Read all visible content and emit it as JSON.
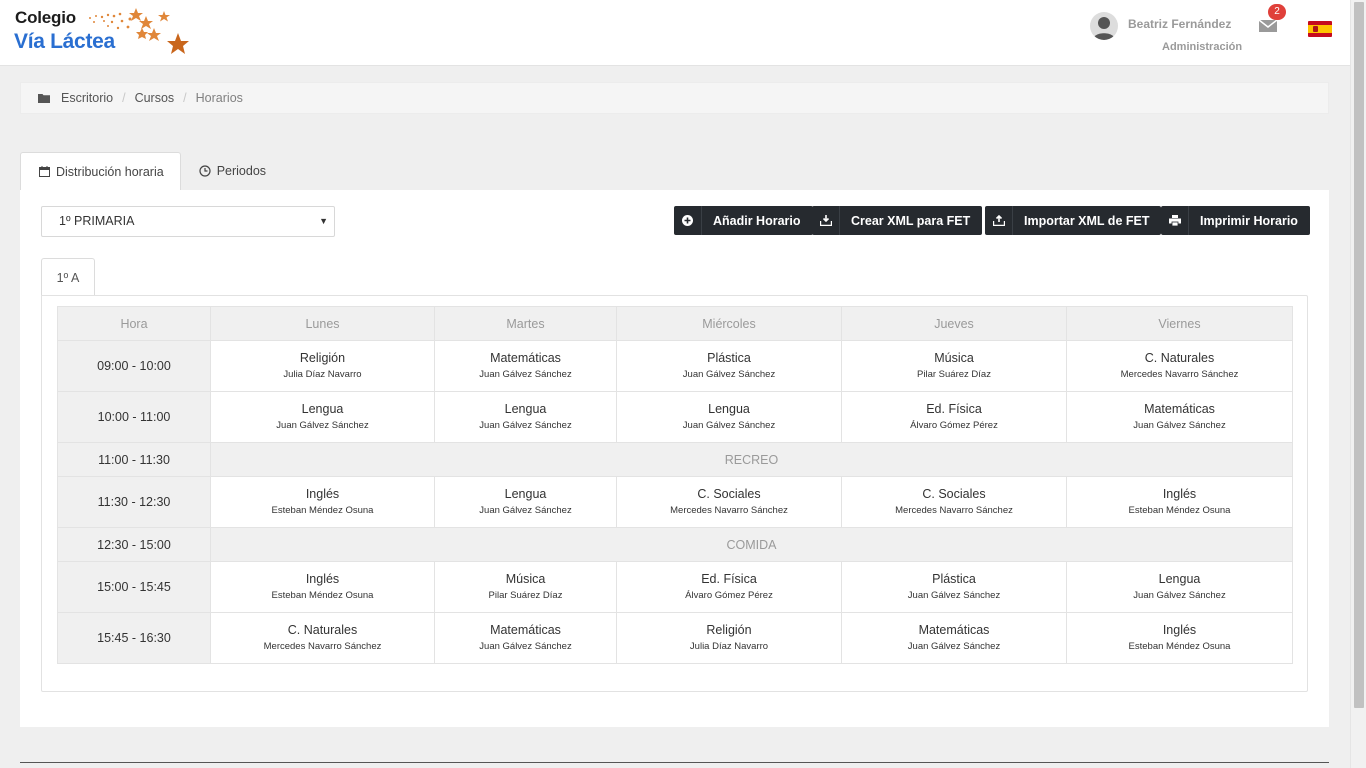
{
  "header": {
    "logo_line1": "Colegio",
    "logo_line2": "Vía Láctea",
    "user_name": "Beatriz Fernández",
    "user_role": "Administración",
    "notifications": "2",
    "language_icon": "spain-flag-icon"
  },
  "breadcrumb": {
    "items": [
      "Escritorio",
      "Cursos",
      "Horarios"
    ]
  },
  "tabs": {
    "distribution": "Distribución horaria",
    "periods": "Periodos"
  },
  "course_select": {
    "value": "1º PRIMARIA"
  },
  "actions": {
    "add": "Añadir Horario",
    "create_xml": "Crear XML para FET",
    "import_xml": "Importar XML de FET",
    "print": "Imprimir Horario"
  },
  "group_tab": "1º A",
  "schedule": {
    "headers": [
      "Hora",
      "Lunes",
      "Martes",
      "Miércoles",
      "Jueves",
      "Viernes"
    ],
    "rows": [
      {
        "hour": "09:00 - 10:00",
        "cells": [
          {
            "subject": "Religión",
            "teacher": "Julia Díaz Navarro"
          },
          {
            "subject": "Matemáticas",
            "teacher": "Juan Gálvez Sánchez"
          },
          {
            "subject": "Plástica",
            "teacher": "Juan Gálvez Sánchez"
          },
          {
            "subject": "Música",
            "teacher": "Pilar Suárez Díaz"
          },
          {
            "subject": "C. Naturales",
            "teacher": "Mercedes Navarro Sánchez"
          }
        ]
      },
      {
        "hour": "10:00 - 11:00",
        "cells": [
          {
            "subject": "Lengua",
            "teacher": "Juan Gálvez Sánchez"
          },
          {
            "subject": "Lengua",
            "teacher": "Juan Gálvez Sánchez"
          },
          {
            "subject": "Lengua",
            "teacher": "Juan Gálvez Sánchez"
          },
          {
            "subject": "Ed. Física",
            "teacher": "Álvaro Gómez Pérez"
          },
          {
            "subject": "Matemáticas",
            "teacher": "Juan Gálvez Sánchez"
          }
        ]
      },
      {
        "hour": "11:00 - 11:30",
        "break": "RECREO"
      },
      {
        "hour": "11:30 - 12:30",
        "cells": [
          {
            "subject": "Inglés",
            "teacher": "Esteban Méndez Osuna"
          },
          {
            "subject": "Lengua",
            "teacher": "Juan Gálvez Sánchez"
          },
          {
            "subject": "C. Sociales",
            "teacher": "Mercedes Navarro Sánchez"
          },
          {
            "subject": "C. Sociales",
            "teacher": "Mercedes Navarro Sánchez"
          },
          {
            "subject": "Inglés",
            "teacher": "Esteban Méndez Osuna"
          }
        ]
      },
      {
        "hour": "12:30 - 15:00",
        "break": "COMIDA"
      },
      {
        "hour": "15:00 - 15:45",
        "cells": [
          {
            "subject": "Inglés",
            "teacher": "Esteban Méndez Osuna"
          },
          {
            "subject": "Música",
            "teacher": "Pilar Suárez Díaz"
          },
          {
            "subject": "Ed. Física",
            "teacher": "Álvaro Gómez Pérez"
          },
          {
            "subject": "Plástica",
            "teacher": "Juan Gálvez Sánchez"
          },
          {
            "subject": "Lengua",
            "teacher": "Juan Gálvez Sánchez"
          }
        ]
      },
      {
        "hour": "15:45 - 16:30",
        "cells": [
          {
            "subject": "C. Naturales",
            "teacher": "Mercedes Navarro Sánchez"
          },
          {
            "subject": "Matemáticas",
            "teacher": "Juan Gálvez Sánchez"
          },
          {
            "subject": "Religión",
            "teacher": "Julia Díaz Navarro"
          },
          {
            "subject": "Matemáticas",
            "teacher": "Juan Gálvez Sánchez"
          },
          {
            "subject": "Inglés",
            "teacher": "Esteban Méndez Osuna"
          }
        ]
      }
    ]
  }
}
